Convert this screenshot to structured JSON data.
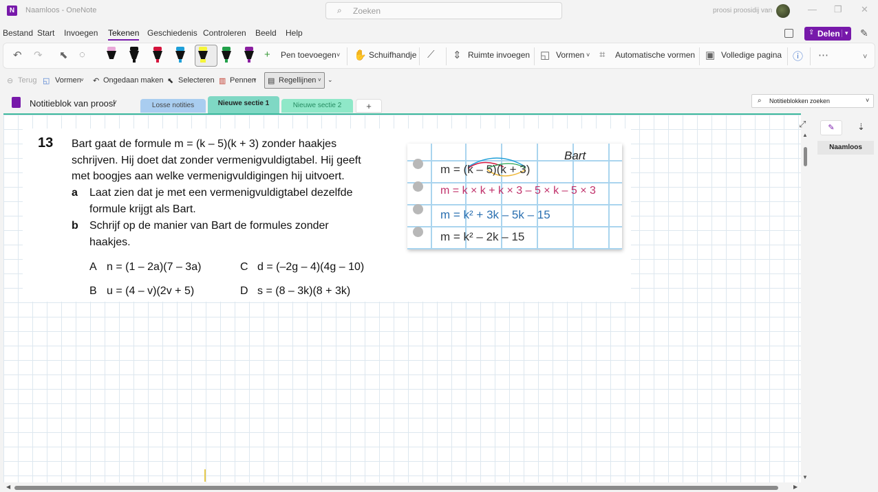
{
  "titlebar": {
    "app_title": "Naamloos - OneNote",
    "search_placeholder": "Zoeken",
    "user_name": "proosi proosidij van",
    "logo_letter": "N"
  },
  "menu": {
    "items": [
      "Bestand",
      "Start",
      "Invoegen",
      "Tekenen",
      "Geschiedenis",
      "Controleren",
      "Beeld",
      "Help"
    ],
    "active": "Tekenen",
    "share_label": "Delen"
  },
  "ribbon": {
    "pen_colors": [
      "#e9a8d8",
      "#111111",
      "#d4143c",
      "#1f9fd8",
      "#f5f53a",
      "#22a04a",
      "#8a1fa0"
    ],
    "add_pen": "Pen toevoegen",
    "hand": "Schuifhandje",
    "insert_space": "Ruimte invoegen",
    "shapes": "Vormen",
    "auto_shapes": "Automatische vormen",
    "full_page": "Volledige pagina"
  },
  "toolbar2": {
    "back": "Terug",
    "shapes": "Vormen",
    "undo": "Ongedaan maken",
    "select": "Selecteren",
    "pens": "Pennen",
    "rule_lines": "Regellijnen"
  },
  "notebook": {
    "name": "Notitieblok van proosi",
    "tabs": [
      {
        "label": "Losse notities",
        "color": "#a9cdf0"
      },
      {
        "label": "Nieuwe sectie 1",
        "color": "#7fd8c4"
      },
      {
        "label": "Nieuwe sectie 2",
        "color": "#8fe8c8"
      }
    ],
    "add_tab": "+",
    "search_placeholder": "Notitieblokken zoeken"
  },
  "pages": {
    "items": [
      "Naamloos"
    ]
  },
  "exercise": {
    "number": "13",
    "intro": [
      "Bart gaat de formule m = (k – 5)(k + 3) zonder haakjes",
      "schrijven. Hij doet dat zonder vermenigvuldigtabel. Hij geeft",
      "met boogjes aan welke vermenigvuldigingen hij uitvoert."
    ],
    "part_a_letter": "a",
    "part_a": [
      "Laat zien dat je met een vermenigvuldigtabel dezelfde",
      "formule krijgt als Bart."
    ],
    "part_b_letter": "b",
    "part_b": [
      "Schrijf op de manier van Bart de formules zonder",
      "haakjes."
    ],
    "options": [
      {
        "letter": "A",
        "formula": "n = (1 – 2a)(7 – 3a)"
      },
      {
        "letter": "B",
        "formula": "u = (4 – v)(2v + 5)"
      },
      {
        "letter": "C",
        "formula": "d = (–2g – 4)(4g – 10)"
      },
      {
        "letter": "D",
        "formula": "s = (8 – 3k)(8 + 3k)"
      }
    ]
  },
  "bart_note": {
    "name": "Bart",
    "lines": [
      "m = (k – 5)(k + 3)",
      "m = k × k + k × 3 – 5 × k – 5 × 3",
      "m = k² + 3k – 5k – 15",
      "m = k² – 2k – 15"
    ]
  }
}
